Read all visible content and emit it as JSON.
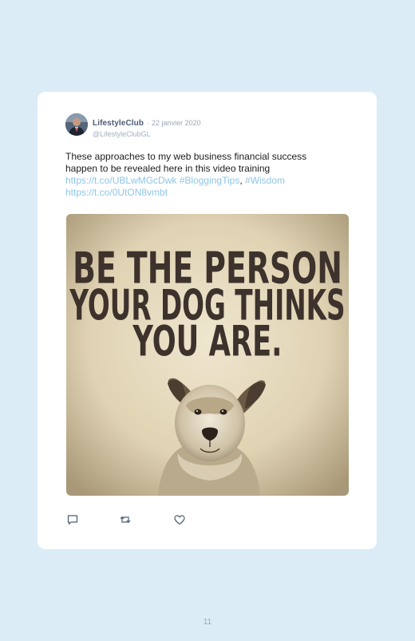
{
  "tweet": {
    "display_name": "LifestyleClub",
    "date": "· 22 janvier 2020",
    "handle": "@LifestyleClubGL",
    "text_line1": "These approaches to my web business financial success",
    "text_line2": "happen to be revealed here in this video training",
    "link1": "https://t.co/UBLwMGcDwk",
    "hashtag1": "#BloggingTips",
    "separator": ",",
    "hashtag2": "#Wisdom",
    "link2": "https://t.co/0UtON8vmbt",
    "image": {
      "line1": "BE THE PERSON",
      "line2": "YOUR DOG THINKS",
      "line3": "YOU ARE."
    }
  },
  "actions": {
    "reply_icon": "speech-bubble",
    "retweet_icon": "retweet-arrows",
    "like_icon": "heart"
  },
  "page": {
    "number": "11"
  },
  "colors": {
    "background": "#dcecf7",
    "card": "#ffffff",
    "link": "#8ec6e6",
    "name": "#4a5d73",
    "muted": "#a3b0bd",
    "image_bg": "#e4d9bf",
    "image_text": "#3d322c"
  }
}
